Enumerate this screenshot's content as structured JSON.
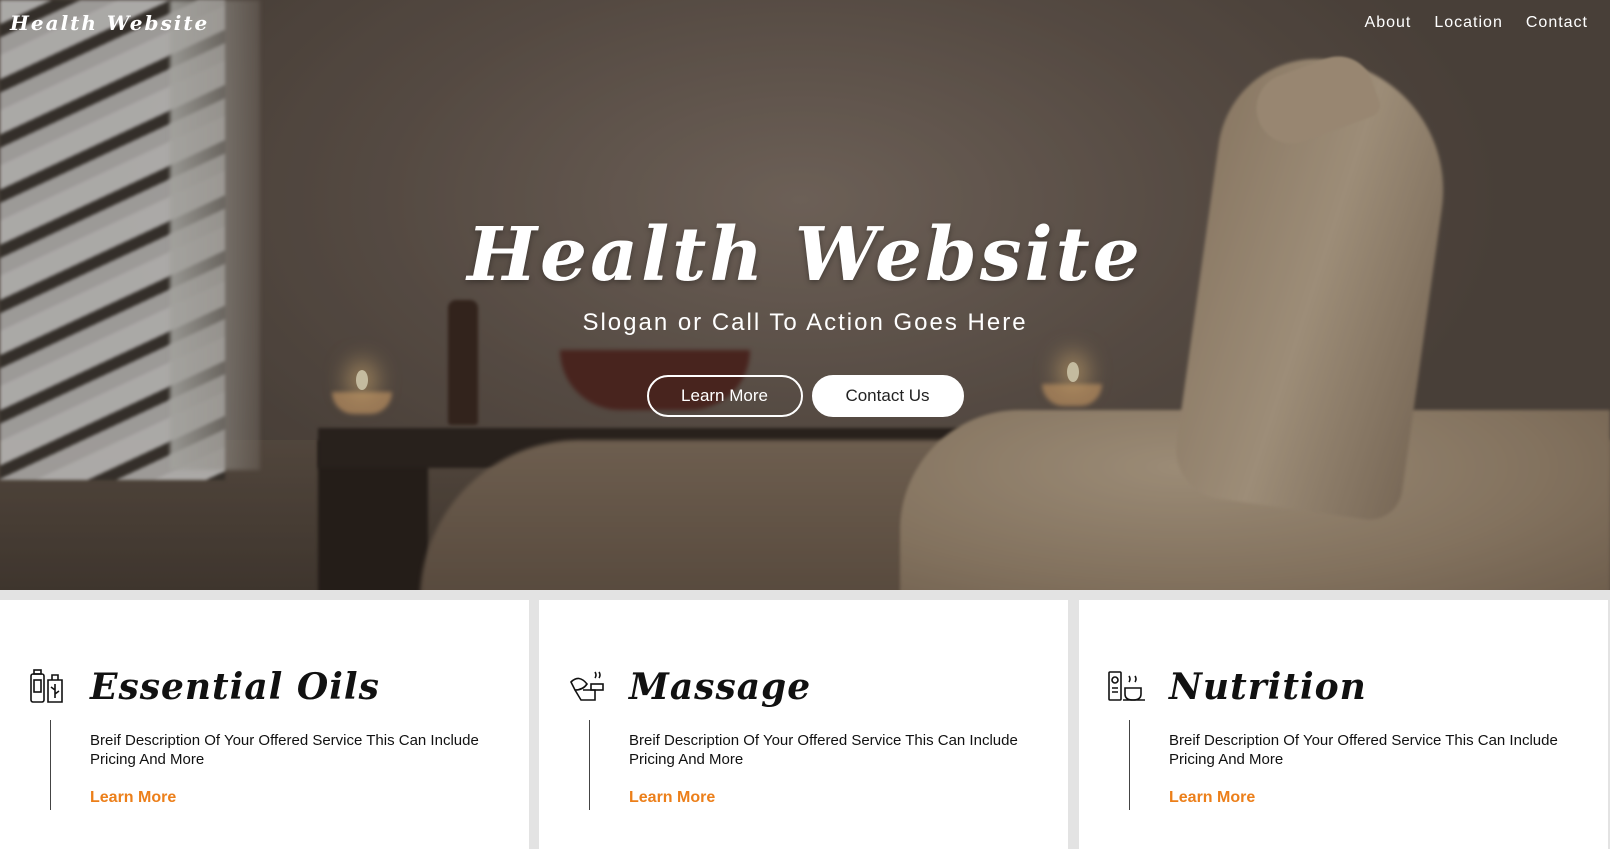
{
  "nav": {
    "brand": "Health Website",
    "links": [
      "About",
      "Location",
      "Contact"
    ]
  },
  "hero": {
    "title": "Health Website",
    "slogan": "Slogan or Call To Action Goes Here",
    "learn_more_label": "Learn More",
    "contact_label": "Contact Us"
  },
  "services": [
    {
      "icon": "essential-oils-icon",
      "title": "Essential Oils",
      "description": "Breif Description Of Your Offered Service This Can Include Pricing And More",
      "link": "Learn More"
    },
    {
      "icon": "massage-icon",
      "title": "Massage",
      "description": "Breif Description Of Your Offered Service This Can Include Pricing And More",
      "link": "Learn More"
    },
    {
      "icon": "nutrition-icon",
      "title": "Nutrition",
      "description": "Breif Description Of Your Offered Service This Can Include Pricing And More",
      "link": "Learn More"
    }
  ],
  "colors": {
    "accent": "#ec7f1a",
    "card_background": "#ffffff",
    "page_background": "#e3e3e3"
  }
}
